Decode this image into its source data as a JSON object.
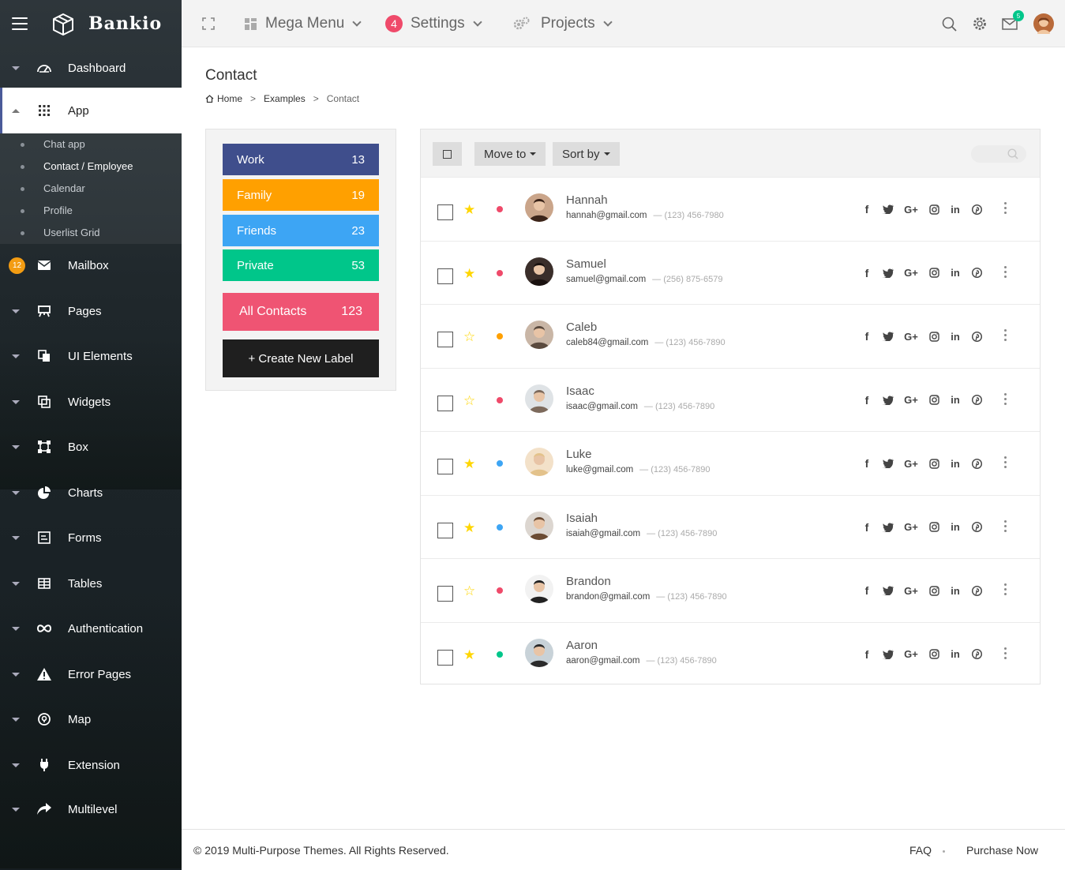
{
  "brand": {
    "name": "Bankio"
  },
  "sidebar": {
    "items": [
      {
        "label": "Dashboard"
      },
      {
        "label": "App"
      },
      {
        "label": "Mailbox",
        "badge": "12"
      },
      {
        "label": "Pages"
      },
      {
        "label": "UI Elements"
      },
      {
        "label": "Widgets"
      },
      {
        "label": "Box"
      },
      {
        "label": "Charts"
      },
      {
        "label": "Forms"
      },
      {
        "label": "Tables"
      },
      {
        "label": "Authentication"
      },
      {
        "label": "Error Pages"
      },
      {
        "label": "Map"
      },
      {
        "label": "Extension"
      },
      {
        "label": "Multilevel"
      }
    ],
    "app_sub": [
      "Chat app",
      "Contact / Employee",
      "Calendar",
      "Profile",
      "Userlist Grid"
    ]
  },
  "topbar": {
    "mega_menu": "Mega Menu",
    "settings": "Settings",
    "settings_badge": "4",
    "projects": "Projects",
    "mail_badge": "5"
  },
  "page": {
    "title": "Contact",
    "breadcrumb": [
      "Home",
      "Examples",
      "Contact"
    ]
  },
  "labels": [
    {
      "name": "Work",
      "count": "13",
      "color": "#3f4e8c"
    },
    {
      "name": "Family",
      "count": "19",
      "color": "#ffa000"
    },
    {
      "name": "Friends",
      "count": "23",
      "color": "#3da5f4"
    },
    {
      "name": "Private",
      "count": "53",
      "color": "#00c68a"
    }
  ],
  "all_contacts": {
    "label": "All Contacts",
    "count": "123",
    "color": "#ef5473"
  },
  "create_label": "+ Create New Label",
  "toolbar": {
    "move_to": "Move to",
    "sort_by": "Sort by"
  },
  "contacts": [
    {
      "name": "Hannah",
      "email": "hannah@gmail.com",
      "phone": "— (123) 456-7980",
      "starred": true,
      "dot": "#ef4a6a"
    },
    {
      "name": "Samuel",
      "email": "samuel@gmail.com",
      "phone": "— (256) 875-6579",
      "starred": true,
      "dot": "#ef4a6a"
    },
    {
      "name": "Caleb",
      "email": "caleb84@gmail.com",
      "phone": "— (123) 456-7890",
      "starred": false,
      "dot": "#ffa000"
    },
    {
      "name": "Isaac",
      "email": "isaac@gmail.com",
      "phone": "— (123) 456-7890",
      "starred": false,
      "dot": "#ef4a6a"
    },
    {
      "name": "Luke",
      "email": "luke@gmail.com",
      "phone": "— (123) 456-7890",
      "starred": true,
      "dot": "#3da5f4"
    },
    {
      "name": "Isaiah",
      "email": "isaiah@gmail.com",
      "phone": "— (123) 456-7890",
      "starred": true,
      "dot": "#3da5f4"
    },
    {
      "name": "Brandon",
      "email": "brandon@gmail.com",
      "phone": "— (123) 456-7890",
      "starred": false,
      "dot": "#ef4a6a"
    },
    {
      "name": "Aaron",
      "email": "aaron@gmail.com",
      "phone": "— (123) 456-7890",
      "starred": true,
      "dot": "#00c68a"
    }
  ],
  "footer": {
    "copyright": "© 2019 Multi-Purpose Themes. All Rights Reserved.",
    "faq": "FAQ",
    "purchase": "Purchase Now"
  }
}
